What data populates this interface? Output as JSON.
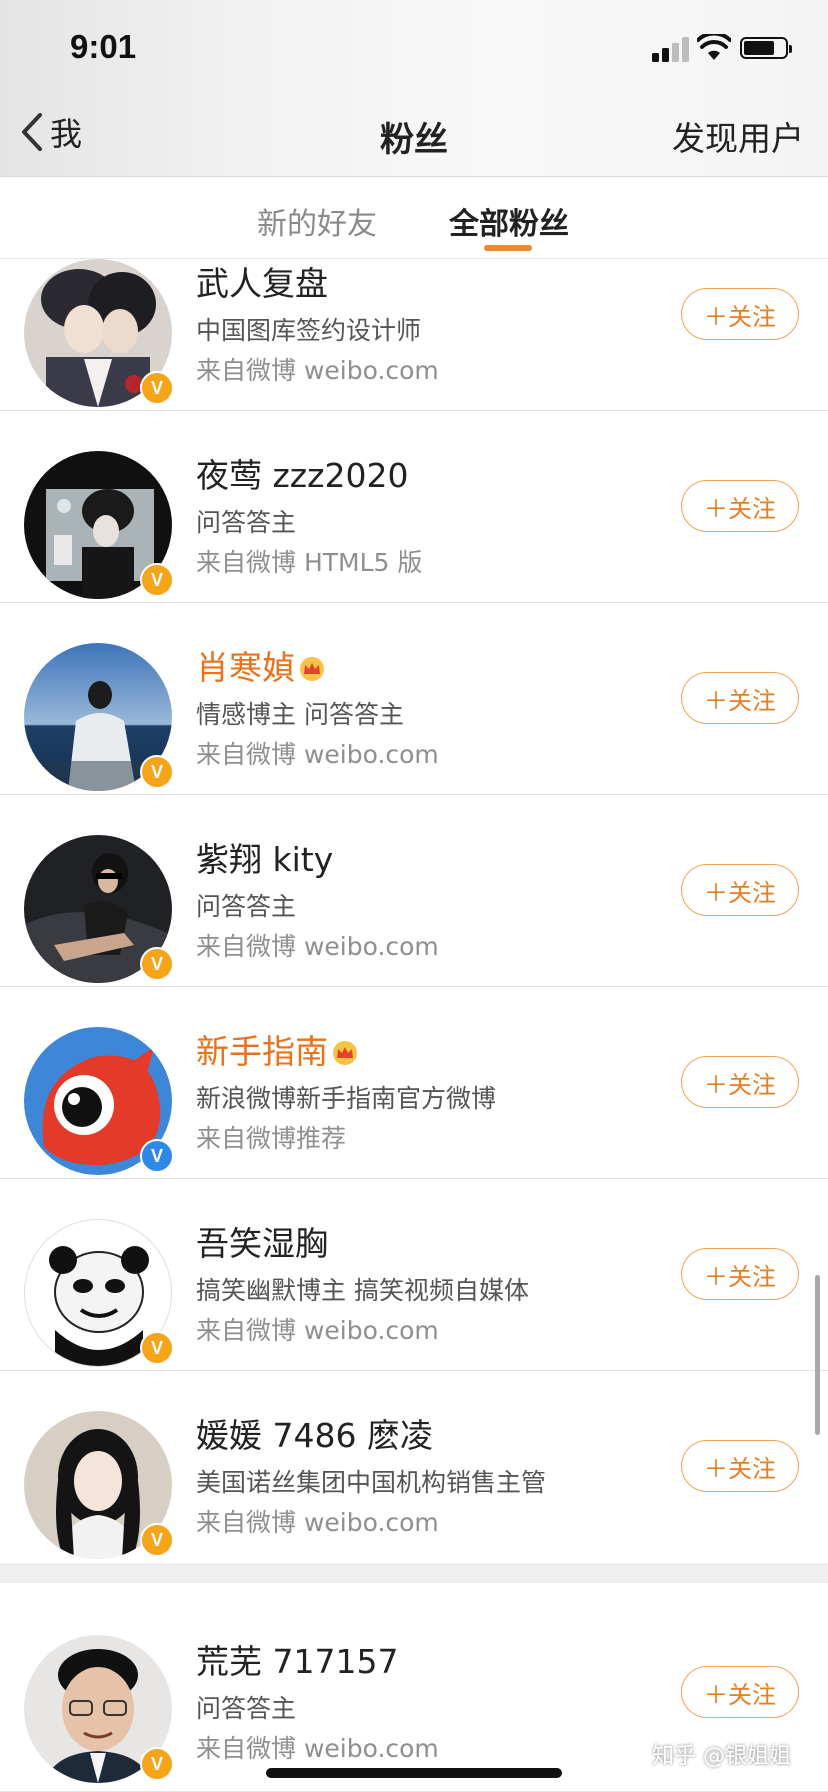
{
  "status_bar": {
    "time": "9:01"
  },
  "nav": {
    "back_label": "我",
    "title": "粉丝",
    "right_action": "发现用户"
  },
  "tabs": [
    {
      "label": "新的好友",
      "active": false
    },
    {
      "label": "全部粉丝",
      "active": true
    }
  ],
  "follow_label": "＋关注",
  "fans": [
    {
      "name": "武人复盘",
      "description": "中国图库签约设计师",
      "source": "来自微博 weibo.com",
      "verified": "gold",
      "vip": false
    },
    {
      "name": "夜莺 zzz2020",
      "description": "问答答主",
      "source": "来自微博 HTML5 版",
      "verified": "gold",
      "vip": false
    },
    {
      "name": "肖寒媜",
      "description": "情感博主 问答答主",
      "source": "来自微博 weibo.com",
      "verified": "gold",
      "vip": true
    },
    {
      "name": "紫翔 kity",
      "description": "问答答主",
      "source": "来自微博 weibo.com",
      "verified": "gold",
      "vip": false
    },
    {
      "name": "新手指南",
      "description": "新浪微博新手指南官方微博",
      "source": "来自微博推荐",
      "verified": "blue",
      "vip": true
    },
    {
      "name": "吾笑湿胸",
      "description": "搞笑幽默博主 搞笑视频自媒体",
      "source": "来自微博 weibo.com",
      "verified": "gold",
      "vip": false
    },
    {
      "name": "媛媛 7486 麽凌",
      "description": "美国诺丝集团中国机构销售主管",
      "source": "来自微博 weibo.com",
      "verified": "gold",
      "vip": false
    },
    {
      "name": "荒芜 717157",
      "description": "问答答主",
      "source": "来自微博 weibo.com",
      "verified": "gold",
      "vip": false
    }
  ],
  "colors": {
    "accent": "#f08a2a",
    "vip_name": "#e8731a",
    "verified_gold": "#f4a51c",
    "verified_blue": "#2f87e6"
  },
  "watermark": "知乎 @银姐姐"
}
